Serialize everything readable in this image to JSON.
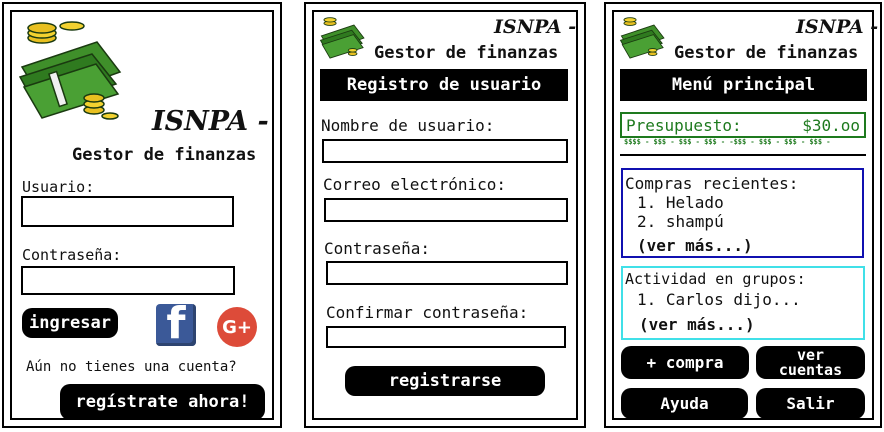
{
  "brand": {
    "title": "ISNPA -",
    "subtitle": "Gestor de finanzas"
  },
  "login": {
    "user_label": "Usuario:",
    "password_label": "Contraseña:",
    "login_button": "ingresar",
    "facebook_letter": "f",
    "google_text": "G+",
    "no_account_text": "Aún no tienes una cuenta?",
    "register_button": "regístrate ahora!"
  },
  "register": {
    "header": "Registro de usuario",
    "username_label": "Nombre de usuario:",
    "email_label": "Correo electrónico:",
    "password_label": "Contraseña:",
    "confirm_label": "Confirmar contraseña:",
    "submit_button": "registrarse"
  },
  "menu": {
    "header": "Menú principal",
    "budget_label": "Presupuesto:",
    "budget_value": "$30.oo",
    "budget_bar_text": "$$$$ - $$$ - $$$ - $$$ - -$$$ - $$$ - $$$ - $$$ -",
    "recent_title": "Compras recientes:",
    "recent_items": [
      "1. Helado",
      "2. shampú"
    ],
    "recent_more": "(ver más...)",
    "groups_title": "Actividad en grupos:",
    "groups_items": [
      "1. Carlos dijo..."
    ],
    "groups_more": "(ver más...)",
    "add_purchase": "+ compra",
    "view_accounts": "ver cuentas",
    "help": "Ayuda",
    "exit": "Salir"
  },
  "colors": {
    "budget_border": "#1e7a1e",
    "budget_text": "#1e7a1e",
    "recent_border": "#1010b0",
    "groups_border": "#40e0e8",
    "facebook": "#3b5998",
    "google": "#dd4b39"
  }
}
